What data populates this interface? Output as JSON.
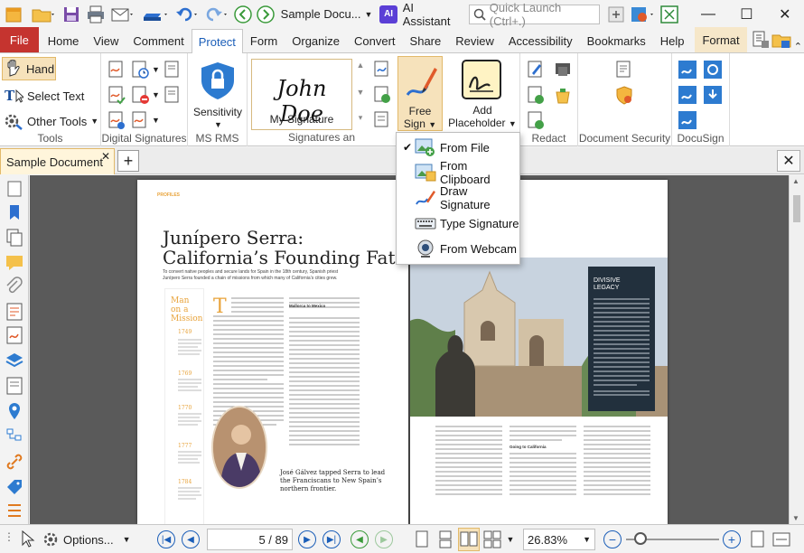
{
  "titlebar": {
    "doc_picker": "Sample Docu...",
    "ai_label": "AI Assistant",
    "ai_badge": "AI",
    "quick_launch_placeholder": "Quick Launch (Ctrl+.)"
  },
  "tabs": [
    "File",
    "Home",
    "View",
    "Comment",
    "Protect",
    "Form",
    "Organize",
    "Convert",
    "Share",
    "Review",
    "Accessibility",
    "Bookmarks",
    "Help",
    "Format"
  ],
  "ribbon": {
    "tools": {
      "hand": "Hand",
      "select_text": "Select Text",
      "other_tools": "Other Tools",
      "group": "Tools"
    },
    "digital_signatures": {
      "group": "Digital Signatures"
    },
    "ms_rms": {
      "sensitivity": "Sensitivity",
      "group": "MS RMS"
    },
    "signatures": {
      "sample_signature": "John Doe",
      "my_signature": "My Signature",
      "free_sign_1": "Free",
      "free_sign_2": "Sign",
      "add_placeholder_1": "Add",
      "add_placeholder_2": "Placeholder",
      "group": "Signatures an"
    },
    "redact": {
      "group": "Redact"
    },
    "doc_security": {
      "group": "Document Security"
    },
    "docusign": {
      "group": "DocuSign"
    }
  },
  "document_tab": {
    "title": "Sample Document"
  },
  "dropdown": {
    "items": [
      {
        "label": "From File",
        "checked": true
      },
      {
        "label": "From Clipboard",
        "checked": false
      },
      {
        "label": "Draw Signature",
        "checked": false
      },
      {
        "label": "Type Signature",
        "checked": false
      },
      {
        "label": "From Webcam",
        "checked": false
      }
    ]
  },
  "page": {
    "section": "PROFILES",
    "headline_1": "Junípero Serra:",
    "headline_2": "California’s Founding Father",
    "deck_1": "To convert native peoples and secure lands for Spain in the 18th century, Spanish priest",
    "deck_2": "Junípero Serra founded a chain of missions from which many of California’s cities grew.",
    "sidebar_title_1": "Man",
    "sidebar_title_2": "on a",
    "sidebar_title_3": "Mission",
    "years": [
      "1749",
      "1769",
      "1770",
      "1777",
      "1784"
    ],
    "body_heading_1": "Mallorca to Mexico",
    "caption_1": "José Gálvez tapped Serra to lead",
    "caption_2": "the Franciscans to New Spain’s",
    "caption_3": "northern frontier.",
    "right_heading": "Going to California",
    "box_title_1": "DIVISIVE",
    "box_title_2": "LEGACY"
  },
  "statusbar": {
    "options": "Options...",
    "page_display": "5 / 89",
    "zoom": "26.83%"
  },
  "colors": {
    "file_tab": "#c5342f",
    "accent_blue": "#1b5eb8",
    "highlight": "#f6e2bb",
    "page_accent": "#e8a33a"
  }
}
